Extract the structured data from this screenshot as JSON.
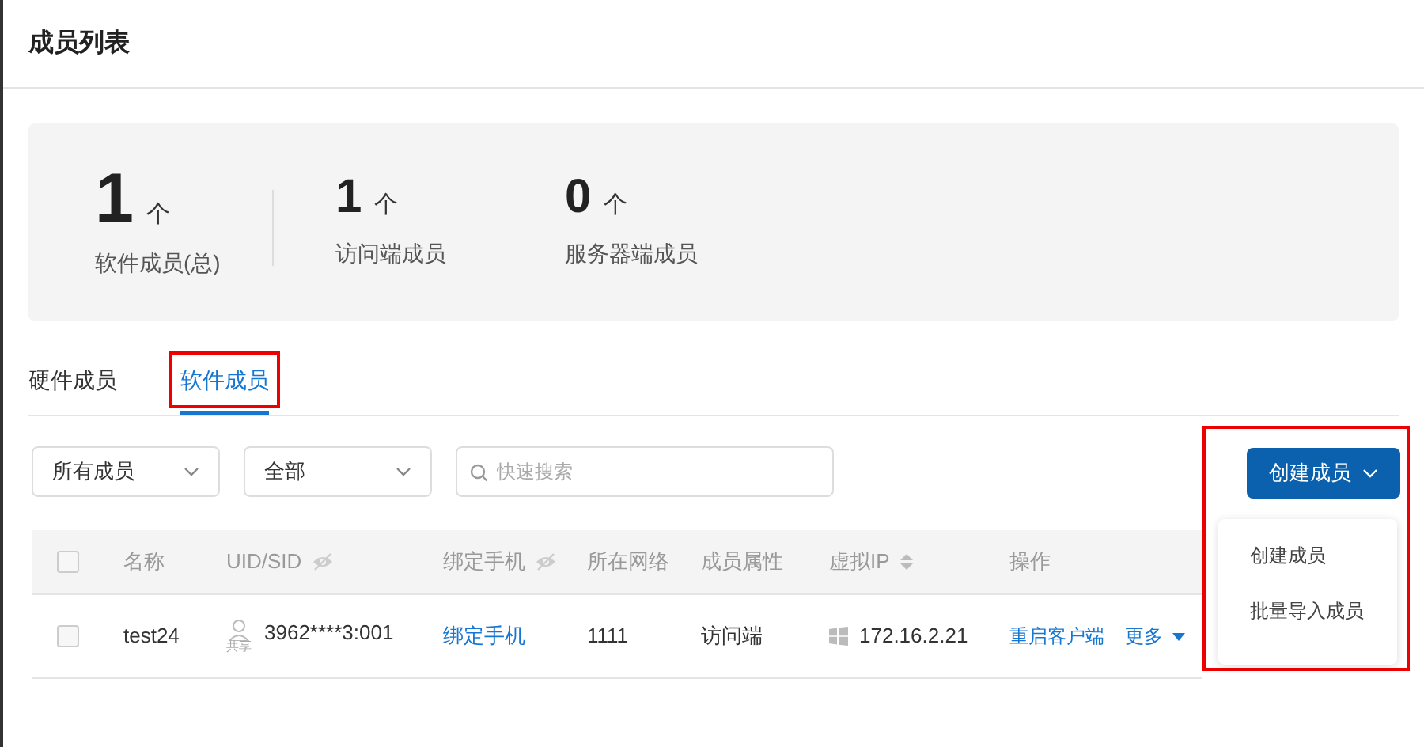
{
  "page_title": "成员列表",
  "stats": [
    {
      "value": "1",
      "unit": "个",
      "label": "软件成员(总)",
      "kind": "large"
    },
    {
      "value": "1",
      "unit": "个",
      "label": "访问端成员",
      "kind": "normal"
    },
    {
      "value": "0",
      "unit": "个",
      "label": "服务器端成员",
      "kind": "normal"
    }
  ],
  "tabs": [
    {
      "label": "硬件成员",
      "selected": false,
      "highlighted": false
    },
    {
      "label": "软件成员",
      "selected": true,
      "highlighted": true
    }
  ],
  "filters": [
    {
      "value": "所有成员"
    },
    {
      "value": "全部"
    }
  ],
  "search": {
    "placeholder": "快速搜索"
  },
  "create_button": {
    "label": "创建成员",
    "highlighted": true
  },
  "create_menu": [
    "创建成员",
    "批量导入成员"
  ],
  "table": {
    "header_checked": false,
    "columns": [
      {
        "label": "名称",
        "kind": "plain"
      },
      {
        "label": "UID/SID",
        "kind": "hideable"
      },
      {
        "label": "绑定手机",
        "kind": "hideable"
      },
      {
        "label": "所在网络",
        "kind": "plain"
      },
      {
        "label": "成员属性",
        "kind": "plain"
      },
      {
        "label": "虚拟IP",
        "kind": "sortable"
      },
      {
        "label": "操作",
        "kind": "plain"
      }
    ],
    "rows": [
      {
        "checked": false,
        "name": "test24",
        "share_label": "共享",
        "uid": "3962****3:001",
        "phone_link": "绑定手机",
        "network": "1111",
        "attribute": "访问端",
        "ip": "172.16.2.21",
        "actions": [
          "重启客户端",
          "更多"
        ]
      }
    ]
  }
}
